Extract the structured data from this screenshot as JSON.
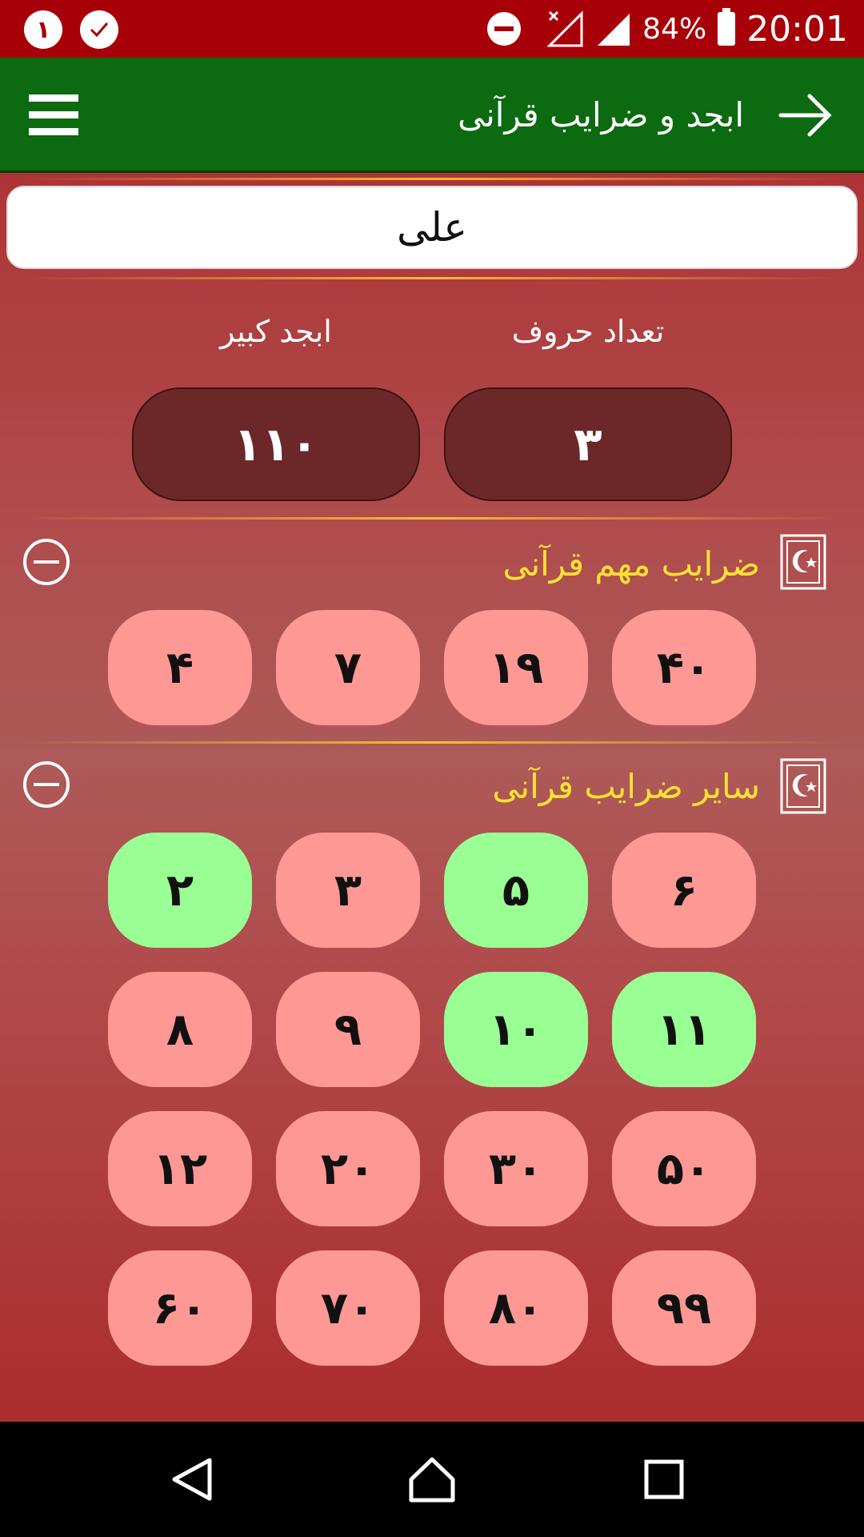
{
  "status_bar": {
    "notif_badge_1": "١",
    "notif_badge_2_icon": "check-icon",
    "battery": "84%",
    "time": "20:01"
  },
  "app_bar": {
    "title": "ابجد و ضرایب قرآنی",
    "back_icon": "arrow-right-icon",
    "menu_icon": "hamburger-menu-icon"
  },
  "input": {
    "value": "علی"
  },
  "stats": {
    "letters_label": "تعداد حروف",
    "letters_value": "٣",
    "abjad_label": "ابجد کبیر",
    "abjad_value": "١١٠"
  },
  "sections": [
    {
      "title": "ضرایب مهم قرآنی",
      "icon": "quran-book-icon",
      "collapse_icon": "minus-circle-icon",
      "buttons": [
        {
          "label": "۴۰",
          "state": "red"
        },
        {
          "label": "۱۹",
          "state": "red"
        },
        {
          "label": "۷",
          "state": "red"
        },
        {
          "label": "۴",
          "state": "red"
        }
      ]
    },
    {
      "title": "سایر ضرایب قرآنی",
      "icon": "quran-book-icon",
      "collapse_icon": "minus-circle-icon",
      "buttons": [
        {
          "label": "۶",
          "state": "red"
        },
        {
          "label": "۵",
          "state": "green"
        },
        {
          "label": "۳",
          "state": "red"
        },
        {
          "label": "۲",
          "state": "green"
        },
        {
          "label": "۱۱",
          "state": "green"
        },
        {
          "label": "۱۰",
          "state": "green"
        },
        {
          "label": "۹",
          "state": "red"
        },
        {
          "label": "۸",
          "state": "red"
        },
        {
          "label": "۵۰",
          "state": "red"
        },
        {
          "label": "۳۰",
          "state": "red"
        },
        {
          "label": "۲۰",
          "state": "red"
        },
        {
          "label": "۱۲",
          "state": "red"
        },
        {
          "label": "۹۹",
          "state": "red"
        },
        {
          "label": "۸۰",
          "state": "red"
        },
        {
          "label": "۷۰",
          "state": "red"
        },
        {
          "label": "۶۰",
          "state": "red"
        }
      ]
    }
  ],
  "colors": {
    "status_bar": "#a80008",
    "app_bar": "#0c6a10",
    "section_title": "#ffe233",
    "button_red": "#fe9895",
    "button_green": "#99fe94",
    "stat_pill": "#6c2829"
  },
  "nav_bar": {
    "back": "back-triangle-icon",
    "home": "home-icon",
    "recents": "recents-square-icon"
  }
}
